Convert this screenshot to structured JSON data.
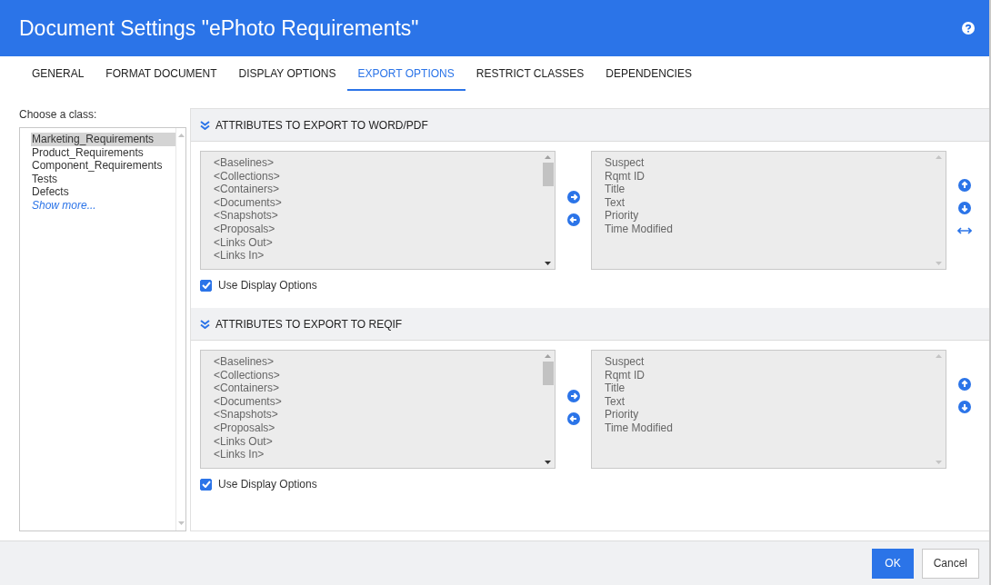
{
  "window": {
    "title": "Document Settings \"ePhoto Requirements\""
  },
  "tabs": [
    {
      "label": "GENERAL",
      "selected": false
    },
    {
      "label": "FORMAT DOCUMENT",
      "selected": false
    },
    {
      "label": "DISPLAY OPTIONS",
      "selected": false
    },
    {
      "label": "EXPORT OPTIONS",
      "selected": true
    },
    {
      "label": "RESTRICT CLASSES",
      "selected": false
    },
    {
      "label": "DEPENDENCIES",
      "selected": false
    }
  ],
  "class_chooser": {
    "label": "Choose a class:",
    "items": [
      {
        "label": "Marketing_Requirements",
        "selected": true,
        "kind": "item"
      },
      {
        "label": "Product_Requirements",
        "selected": false,
        "kind": "item"
      },
      {
        "label": "Component_Requirements",
        "selected": false,
        "kind": "item"
      },
      {
        "label": "Tests",
        "selected": false,
        "kind": "item"
      },
      {
        "label": "Defects",
        "selected": false,
        "kind": "item"
      },
      {
        "label": "Show more...",
        "selected": false,
        "kind": "link"
      }
    ]
  },
  "sections": [
    {
      "title": "ATTRIBUTES TO EXPORT TO WORD/PDF",
      "expanded": true,
      "available": [
        "<Baselines>",
        "<Collections>",
        "<Containers>",
        "<Documents>",
        "<Snapshots>",
        "<Proposals>",
        "<Links Out>",
        "<Links In>"
      ],
      "selected": [
        "Suspect",
        "Rqmt ID",
        "Title",
        "Text",
        "Priority",
        "Time Modified"
      ],
      "order_controls": [
        {
          "kind": "up"
        },
        {
          "kind": "down"
        },
        {
          "kind": "swap"
        }
      ],
      "use_display_options": {
        "label": "Use Display Options",
        "checked": true
      }
    },
    {
      "title": "ATTRIBUTES TO EXPORT TO REQIF",
      "expanded": true,
      "available": [
        "<Baselines>",
        "<Collections>",
        "<Containers>",
        "<Documents>",
        "<Snapshots>",
        "<Proposals>",
        "<Links Out>",
        "<Links In>"
      ],
      "selected": [
        "Suspect",
        "Rqmt ID",
        "Title",
        "Text",
        "Priority",
        "Time Modified"
      ],
      "order_controls": [
        {
          "kind": "up"
        },
        {
          "kind": "down"
        }
      ],
      "use_display_options": {
        "label": "Use Display Options",
        "checked": true
      }
    }
  ],
  "buttons": [
    {
      "label": "OK",
      "kind": "primary"
    },
    {
      "label": "Cancel",
      "kind": "secondary"
    }
  ]
}
